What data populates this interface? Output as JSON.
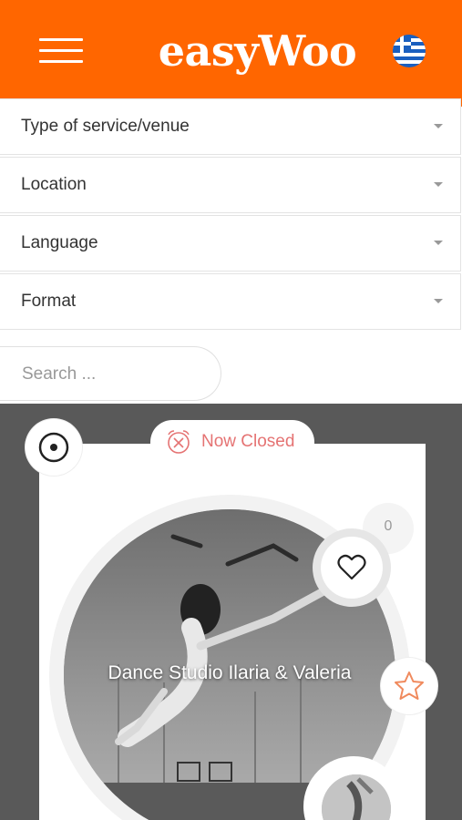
{
  "header": {
    "logo": "easyWoo",
    "language_flag": "greek-flag-icon",
    "brand_color": "#ff6600"
  },
  "filters": {
    "service_type": "Type of service/venue",
    "location": "Location",
    "language": "Language",
    "format": "Format"
  },
  "search": {
    "placeholder": "Search ..."
  },
  "listing": {
    "status": "Now Closed",
    "status_color": "#e57373",
    "title": "Dance Studio Ilaria & Valeria",
    "likes_count": "0",
    "favorite_icon_color": "#f08a5d"
  }
}
